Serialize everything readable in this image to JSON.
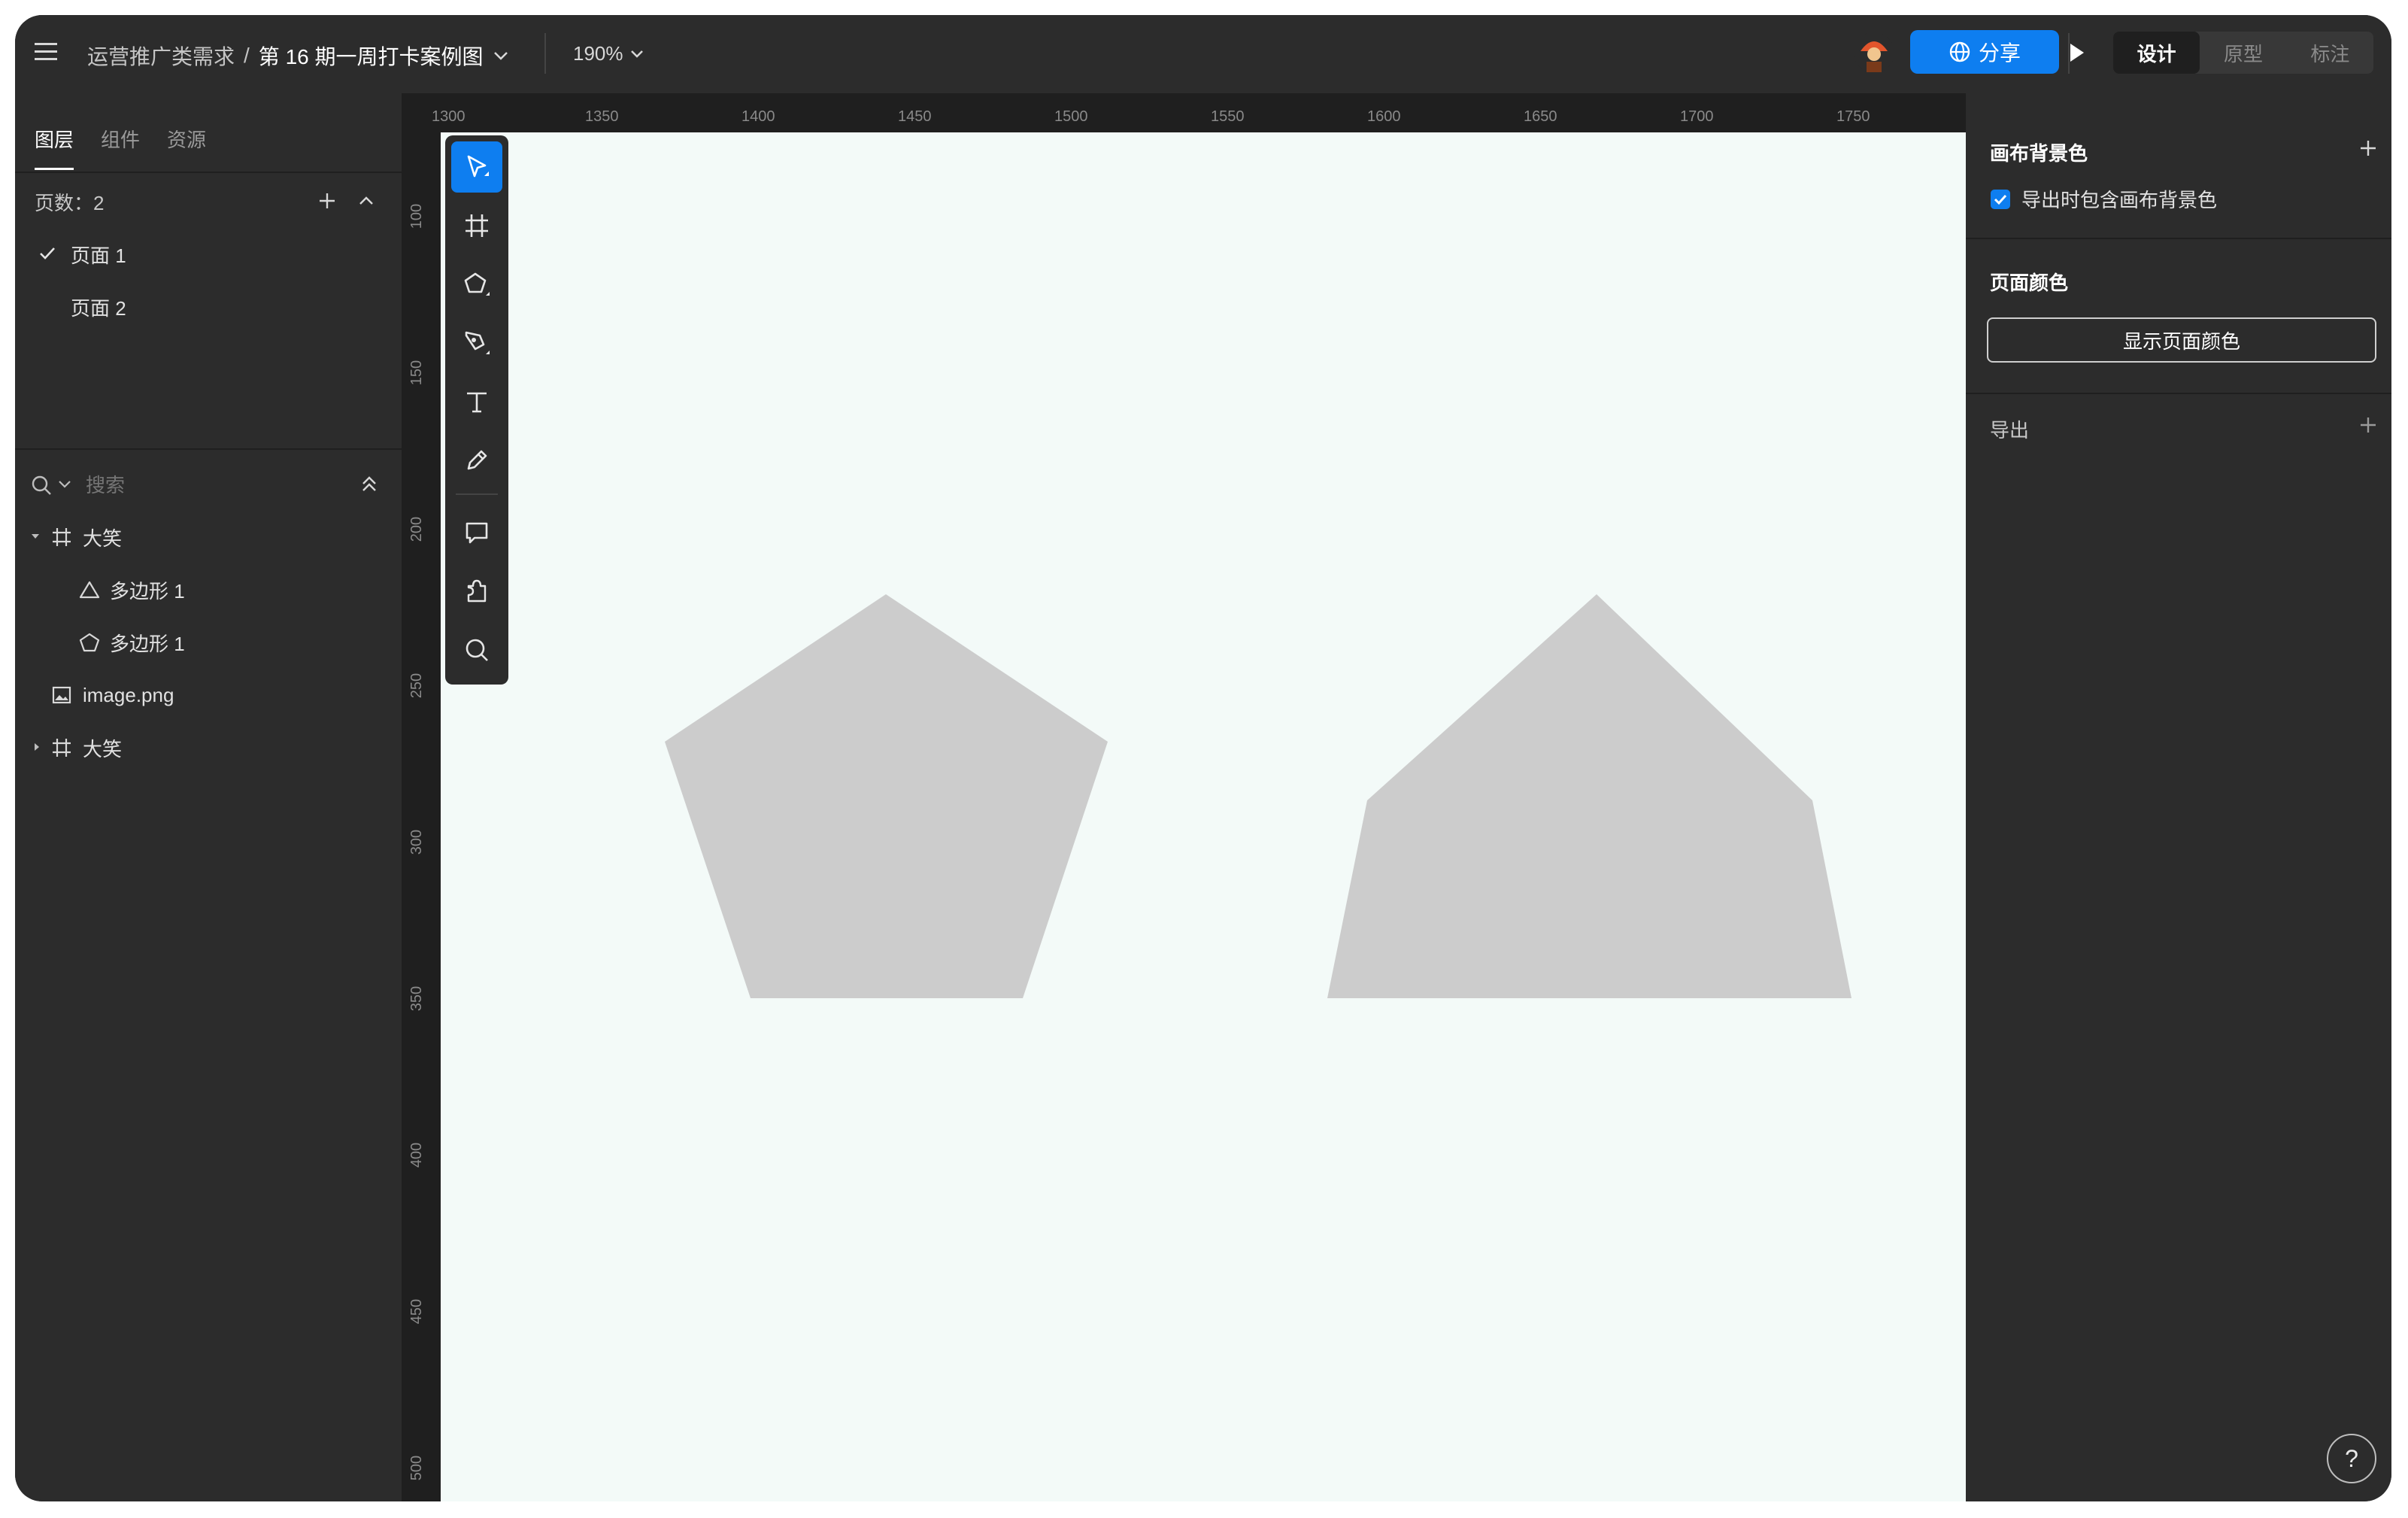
{
  "topbar": {
    "menu_icon": "hamburger-icon",
    "breadcrumb_parent": "运营推广类需求",
    "breadcrumb_separator": "/",
    "file_title": "第 16 期一周打卡案例图",
    "zoom": "190%",
    "share_label": "分享",
    "mode_tabs": [
      "设计",
      "原型",
      "标注"
    ],
    "active_mode": "设计"
  },
  "left_panel": {
    "tabs": [
      "图层",
      "组件",
      "资源"
    ],
    "active_tab": "图层",
    "pages_count_label": "页数：2",
    "pages": [
      {
        "label": "页面 1",
        "selected": true
      },
      {
        "label": "页面 2",
        "selected": false
      }
    ],
    "search_placeholder": "搜索",
    "layers": [
      {
        "label": "大笑",
        "type": "frame",
        "expanded": true,
        "depth": 0
      },
      {
        "label": "多边形 1",
        "type": "triangle",
        "depth": 1
      },
      {
        "label": "多边形 1",
        "type": "pentagon",
        "depth": 1
      },
      {
        "label": "image.png",
        "type": "image",
        "depth": 0
      },
      {
        "label": "大笑",
        "type": "frame",
        "expanded": false,
        "depth": 0
      }
    ]
  },
  "canvas": {
    "ruler_top": [
      "1300",
      "1350",
      "1400",
      "1450",
      "1500",
      "1550",
      "1600",
      "1650",
      "1700",
      "1750"
    ],
    "ruler_left": [
      "100",
      "150",
      "200",
      "250",
      "300",
      "350",
      "400",
      "450",
      "500"
    ],
    "background_color": "#f3faf8",
    "shape_color": "#cccccc",
    "tools": [
      "select-icon",
      "frame-icon",
      "polygon-icon",
      "pen-icon",
      "text-icon",
      "pencil-icon",
      "comment-icon",
      "plugin-icon",
      "search-icon"
    ]
  },
  "right_panel": {
    "canvas_bg_title": "画布背景色",
    "export_bg_label": "导出时包含画布背景色",
    "export_bg_checked": true,
    "page_color_title": "页面颜色",
    "show_page_color_button": "显示页面颜色",
    "export_title": "导出"
  },
  "help_label": "?"
}
